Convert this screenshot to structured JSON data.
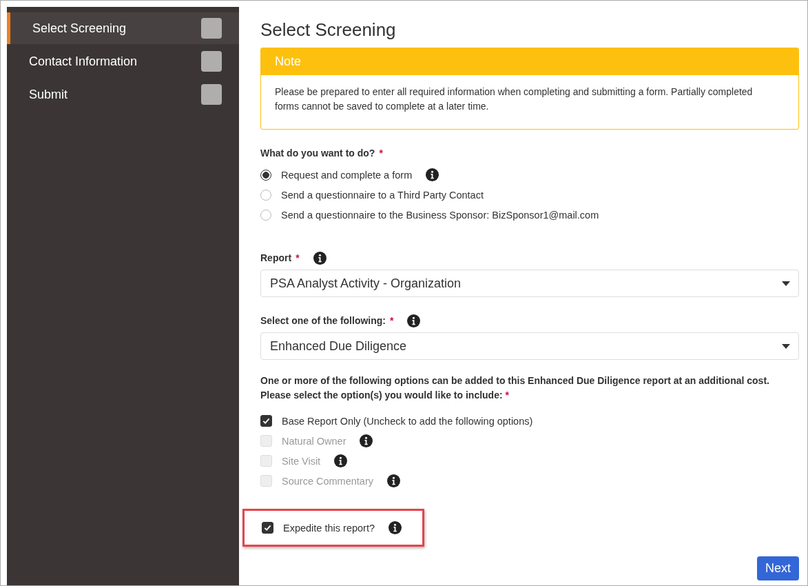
{
  "sidebar": {
    "items": [
      {
        "label": "Select Screening",
        "selected": true
      },
      {
        "label": "Contact Information",
        "selected": false
      },
      {
        "label": "Submit",
        "selected": false
      }
    ]
  },
  "title": "Select Screening",
  "note": {
    "heading": "Note",
    "text": "Please be prepared to enter all required information when completing and submitting a form. Partially completed forms cannot be saved to complete at a later time."
  },
  "action_question": {
    "label": "What do you want to do?",
    "required_mark": "*",
    "options": [
      {
        "label": "Request and complete a form",
        "selected": true,
        "info": true
      },
      {
        "label": "Send a questionnaire to a Third Party Contact",
        "selected": false,
        "info": false
      },
      {
        "label": "Send a questionnaire to the Business Sponsor: BizSponsor1@mail.com",
        "selected": false,
        "info": false
      }
    ]
  },
  "report": {
    "label": "Report",
    "required_mark": "*",
    "value": "PSA Analyst Activity - Organization"
  },
  "screening_type": {
    "label": "Select one of the following:",
    "required_mark": "*",
    "value": "Enhanced Due Diligence"
  },
  "options_question": {
    "label": "One or more of the following options can be added to this Enhanced Due Diligence report at an additional cost. Please select the option(s) you would like to include:",
    "required_mark": "*",
    "options": [
      {
        "label": "Base Report Only (Uncheck to add the following options)",
        "checked": true,
        "disabled": false,
        "info": false
      },
      {
        "label": "Natural Owner",
        "checked": false,
        "disabled": true,
        "info": true
      },
      {
        "label": "Site Visit",
        "checked": false,
        "disabled": true,
        "info": true
      },
      {
        "label": "Source Commentary",
        "checked": false,
        "disabled": true,
        "info": true
      }
    ]
  },
  "expedite": {
    "label": "Expedite this report?",
    "checked": true,
    "info": true,
    "highlighted": true
  },
  "next_button": "Next"
}
